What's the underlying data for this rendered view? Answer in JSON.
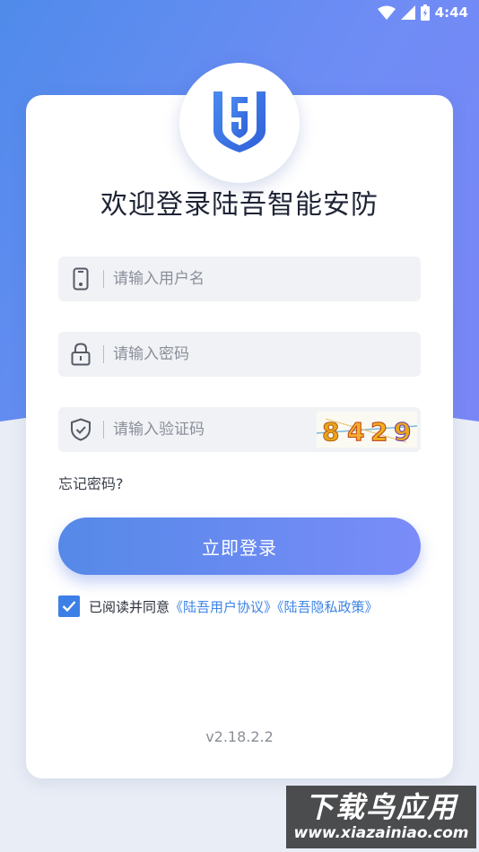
{
  "status_bar": {
    "time": "4:44"
  },
  "title": "欢迎登录陆吾智能安防",
  "fields": {
    "username_placeholder": "请输入用户名",
    "password_placeholder": "请输入密码",
    "captcha_placeholder": "请输入验证码",
    "captcha_code": "8429"
  },
  "forgot_password": "忘记密码?",
  "login_button": "立即登录",
  "agreement": {
    "checked": true,
    "text": "已阅读并同意",
    "user_agreement": "《陆吾用户协议》",
    "privacy_policy": "《陆吾隐私政策》"
  },
  "version": "v2.18.2.2",
  "watermark": {
    "title": "下载鸟应用",
    "url": "www.xiazainiao.com"
  },
  "colors": {
    "brand_blue": "#3c7fe6",
    "button_gradient_start": "#5589e8",
    "button_gradient_end": "#7a8cf8"
  }
}
